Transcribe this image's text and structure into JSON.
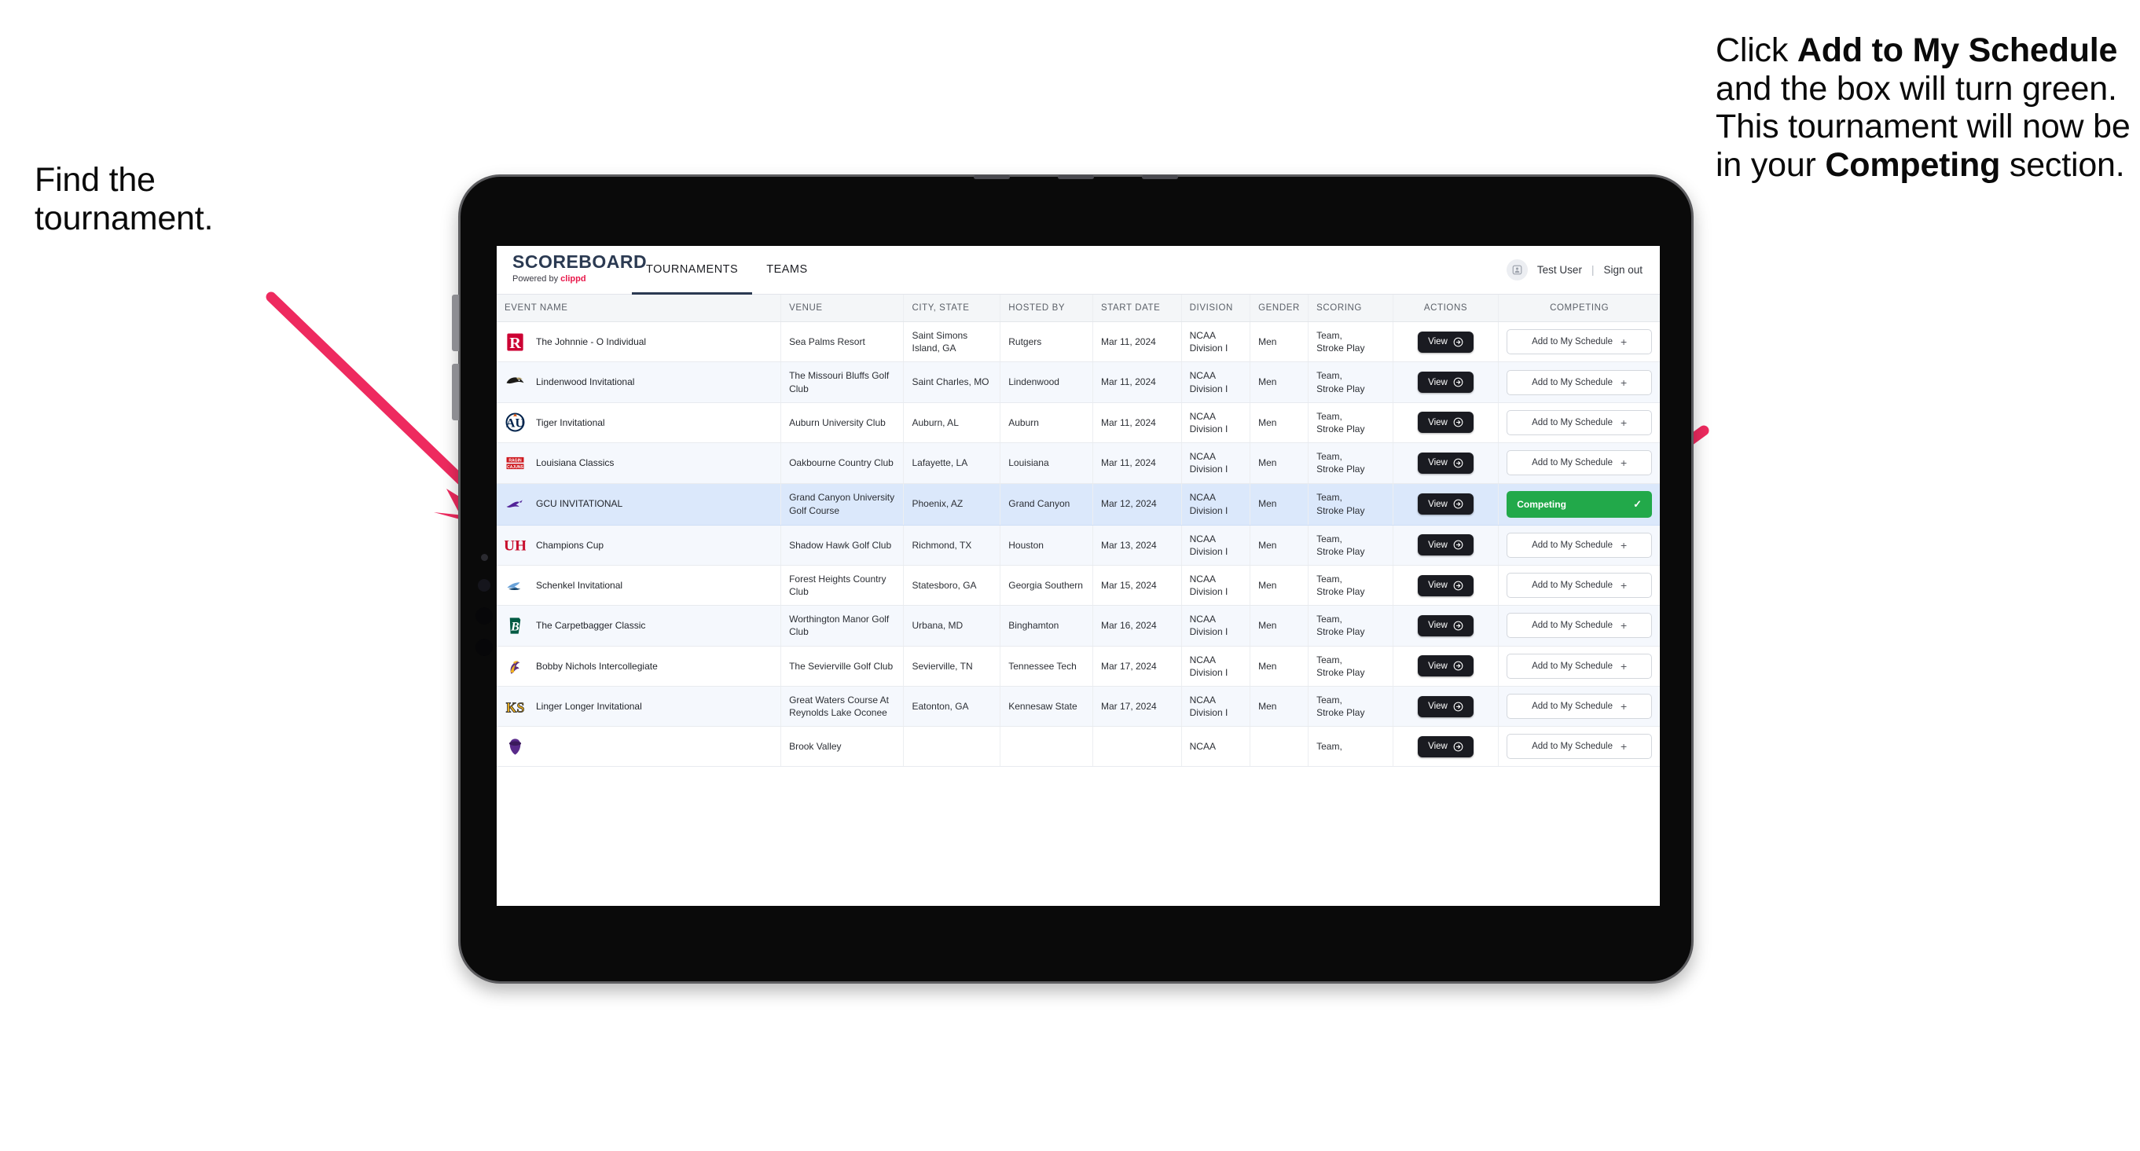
{
  "annotations": {
    "left": {
      "line1": "Find the",
      "line2": "tournament."
    },
    "right": {
      "seg1": "Click ",
      "seg2_bold": "Add to My Schedule",
      "seg3": " and the box will turn green. This tournament will now be in your ",
      "seg4_bold": "Competing",
      "seg5": " section."
    },
    "arrow_color": "#ee2a5f"
  },
  "app": {
    "brand": {
      "title": "SCOREBOARD",
      "powered_prefix": "Powered by ",
      "powered_brand": "clippd"
    },
    "tabs": [
      {
        "label": "TOURNAMENTS",
        "active": true
      },
      {
        "label": "TEAMS",
        "active": false
      }
    ],
    "header_right": {
      "avatar_icon": "user-badge-icon",
      "user": "Test User",
      "separator": "|",
      "signout": "Sign out"
    },
    "colors": {
      "brand_navy": "#2b3a52",
      "brand_pink": "#e8174a",
      "competing_green": "#22a94a",
      "dark_button": "#1a1b21"
    },
    "table": {
      "columns": [
        "EVENT NAME",
        "VENUE",
        "CITY, STATE",
        "HOSTED BY",
        "START DATE",
        "DIVISION",
        "GENDER",
        "SCORING",
        "ACTIONS",
        "COMPETING"
      ],
      "view_label": "View",
      "add_label": "Add to My Schedule",
      "add_plus": "+",
      "competing_label": "Competing",
      "competing_check": "✓",
      "rows": [
        {
          "logo": "rutgers-r-logo",
          "event": "The Johnnie - O Individual",
          "venue": "Sea Palms Resort",
          "city": "Saint Simons Island, GA",
          "host": "Rutgers",
          "date": "Mar 11, 2024",
          "division": "NCAA Division I",
          "gender": "Men",
          "scoring": "Team, Stroke Play",
          "competing": false
        },
        {
          "logo": "lindenwood-lion-logo",
          "event": "Lindenwood Invitational",
          "venue": "The Missouri Bluffs Golf Club",
          "city": "Saint Charles, MO",
          "host": "Lindenwood",
          "date": "Mar 11, 2024",
          "division": "NCAA Division I",
          "gender": "Men",
          "scoring": "Team, Stroke Play",
          "competing": false
        },
        {
          "logo": "auburn-au-logo",
          "event": "Tiger Invitational",
          "venue": "Auburn University Club",
          "city": "Auburn, AL",
          "host": "Auburn",
          "date": "Mar 11, 2024",
          "division": "NCAA Division I",
          "gender": "Men",
          "scoring": "Team, Stroke Play",
          "competing": false
        },
        {
          "logo": "louisiana-ragin-cajuns-logo",
          "event": "Louisiana Classics",
          "venue": "Oakbourne Country Club",
          "city": "Lafayette, LA",
          "host": "Louisiana",
          "date": "Mar 11, 2024",
          "division": "NCAA Division I",
          "gender": "Men",
          "scoring": "Team, Stroke Play",
          "competing": false
        },
        {
          "logo": "grand-canyon-lopes-logo",
          "event": "GCU INVITATIONAL",
          "venue": "Grand Canyon University Golf Course",
          "city": "Phoenix, AZ",
          "host": "Grand Canyon",
          "date": "Mar 12, 2024",
          "division": "NCAA Division I",
          "gender": "Men",
          "scoring": "Team, Stroke Play",
          "competing": true,
          "selected": true
        },
        {
          "logo": "houston-uh-logo",
          "event": "Champions Cup",
          "venue": "Shadow Hawk Golf Club",
          "city": "Richmond, TX",
          "host": "Houston",
          "date": "Mar 13, 2024",
          "division": "NCAA Division I",
          "gender": "Men",
          "scoring": "Team, Stroke Play",
          "competing": false
        },
        {
          "logo": "georgia-southern-eagles-logo",
          "event": "Schenkel Invitational",
          "venue": "Forest Heights Country Club",
          "city": "Statesboro, GA",
          "host": "Georgia Southern",
          "date": "Mar 15, 2024",
          "division": "NCAA Division I",
          "gender": "Men",
          "scoring": "Team, Stroke Play",
          "competing": false
        },
        {
          "logo": "binghamton-b-logo",
          "event": "The Carpetbagger Classic",
          "venue": "Worthington Manor Golf Club",
          "city": "Urbana, MD",
          "host": "Binghamton",
          "date": "Mar 16, 2024",
          "division": "NCAA Division I",
          "gender": "Men",
          "scoring": "Team, Stroke Play",
          "competing": false
        },
        {
          "logo": "tennessee-tech-eagle-logo",
          "event": "Bobby Nichols Intercollegiate",
          "venue": "The Sevierville Golf Club",
          "city": "Sevierville, TN",
          "host": "Tennessee Tech",
          "date": "Mar 17, 2024",
          "division": "NCAA Division I",
          "gender": "Men",
          "scoring": "Team, Stroke Play",
          "competing": false
        },
        {
          "logo": "kennesaw-state-ks-logo",
          "event": "Linger Longer Invitational",
          "venue": "Great Waters Course At Reynolds Lake Oconee",
          "city": "Eatonton, GA",
          "host": "Kennesaw State",
          "date": "Mar 17, 2024",
          "division": "NCAA Division I",
          "gender": "Men",
          "scoring": "Team, Stroke Play",
          "competing": false
        },
        {
          "logo": "east-carolina-pirate-logo",
          "event": "",
          "venue": "Brook Valley",
          "city": "",
          "host": "",
          "date": "",
          "division": "NCAA",
          "gender": "",
          "scoring": "Team,",
          "competing": false,
          "partial": true
        }
      ]
    }
  }
}
